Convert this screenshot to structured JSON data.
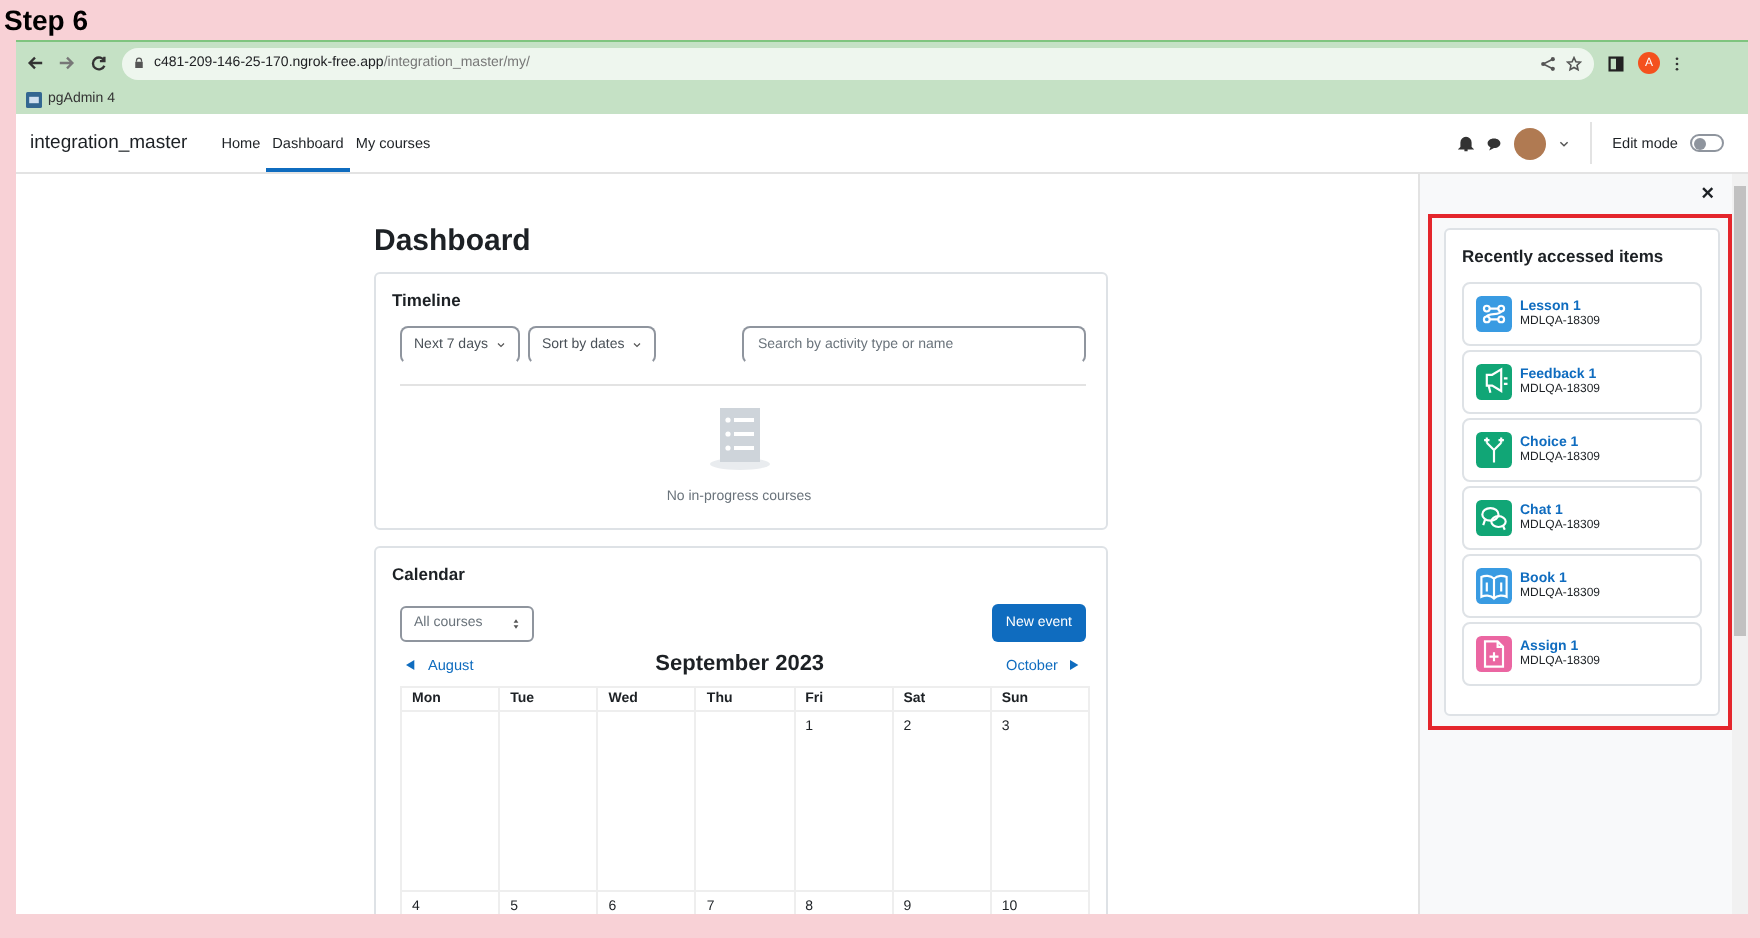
{
  "page_heading": "Step 6",
  "browser": {
    "url_host": "c481-209-146-25-170.ngrok-free.app",
    "url_path": "/integration_master/my/",
    "profile_initial": "A",
    "bookmarks": [
      {
        "label": "pgAdmin 4"
      }
    ]
  },
  "navbar": {
    "brand": "integration_master",
    "links": [
      {
        "label": "Home",
        "selected": false
      },
      {
        "label": "Dashboard",
        "selected": true
      },
      {
        "label": "My courses",
        "selected": false
      }
    ],
    "edit_mode": {
      "label": "Edit mode",
      "on": false
    }
  },
  "dashboard": {
    "title": "Dashboard",
    "timeline": {
      "title": "Timeline",
      "filters": [
        "Next 7 days",
        "Sort by dates"
      ],
      "search": {
        "placeholder": "Search by activity type or name"
      },
      "empty_message": "No in-progress courses"
    },
    "calendar": {
      "title": "Calendar",
      "course_filter": "All courses",
      "new_event": "New event",
      "prev_month": "August",
      "month": "September 2023",
      "next_month": "October",
      "weekdays": [
        "Mon",
        "Tue",
        "Wed",
        "Thu",
        "Fri",
        "Sat",
        "Sun"
      ],
      "weeks": [
        [
          "1",
          "2",
          "3"
        ],
        [
          "4",
          "5",
          "6",
          "7",
          "8",
          "9",
          "10"
        ]
      ]
    }
  },
  "drawer": {
    "close": "×",
    "title": "Recently accessed items",
    "items": [
      {
        "name": "Lesson 1",
        "course": "MDLQA-18309",
        "kind": "lesson",
        "color": "#399be2"
      },
      {
        "name": "Feedback 1",
        "course": "MDLQA-18309",
        "kind": "feedback",
        "color": "#11a676"
      },
      {
        "name": "Choice 1",
        "course": "MDLQA-18309",
        "kind": "choice",
        "color": "#11a676"
      },
      {
        "name": "Chat 1",
        "course": "MDLQA-18309",
        "kind": "chat",
        "color": "#11a676"
      },
      {
        "name": "Book 1",
        "course": "MDLQA-18309",
        "kind": "book",
        "color": "#399be2"
      },
      {
        "name": "Assign 1",
        "course": "MDLQA-18309",
        "kind": "assign",
        "color": "#eb66a2"
      }
    ]
  }
}
